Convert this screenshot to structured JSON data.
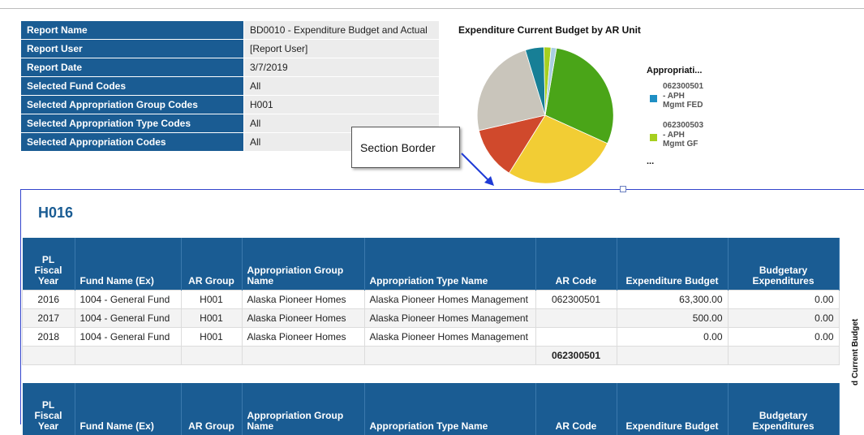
{
  "params": [
    {
      "label": "Report Name",
      "value": "BD0010 - Expenditure Budget and Actual"
    },
    {
      "label": "Report User",
      "value": "[Report User]"
    },
    {
      "label": "Report Date",
      "value": "3/7/2019"
    },
    {
      "label": "Selected Fund Codes",
      "value": "All"
    },
    {
      "label": "Selected Appropriation Group Codes",
      "value": "H001"
    },
    {
      "label": "Selected Appropriation Type Codes",
      "value": "All"
    },
    {
      "label": "Selected Appropriation Codes",
      "value": "All"
    }
  ],
  "pie": {
    "title": "Expenditure Current Budget by AR Unit",
    "legend_title": "Appropriati...",
    "legend_items": [
      {
        "code": "062300501",
        "name": "- APH Mgmt FED",
        "color": "#1f8fc4"
      },
      {
        "code": "062300503",
        "name": "- APH Mgmt GF",
        "color": "#a6cf1f"
      }
    ],
    "legend_more": "...",
    "slices_colors": [
      "#4aa518",
      "#f2cd34",
      "#d0492c",
      "#c9c5bb",
      "#177f96",
      "#a6cf1f",
      "#a9cfe0"
    ]
  },
  "callout": {
    "text": "Section Border"
  },
  "section": {
    "title": "H016"
  },
  "table": {
    "headers": [
      "PL Fiscal Year",
      "Fund Name (Ex)",
      "AR Group",
      "Appropriation Group Name",
      "Appropriation Type Name",
      "AR Code",
      "Expenditure Budget",
      "Budgetary Expenditures"
    ],
    "rows": [
      [
        "2016",
        "1004 - General Fund",
        "H001",
        "Alaska Pioneer Homes",
        "Alaska Pioneer Homes Management",
        "062300501",
        "63,300.00",
        "0.00"
      ],
      [
        "2017",
        "1004 - General Fund",
        "H001",
        "Alaska Pioneer Homes",
        "Alaska Pioneer Homes Management",
        "",
        "500.00",
        "0.00"
      ],
      [
        "2018",
        "1004 - General Fund",
        "H001",
        "Alaska Pioneer Homes",
        "Alaska Pioneer Homes Management",
        "",
        "0.00",
        "0.00"
      ]
    ],
    "subtotal_code": "062300501"
  },
  "side_text": "d Current Budget"
}
